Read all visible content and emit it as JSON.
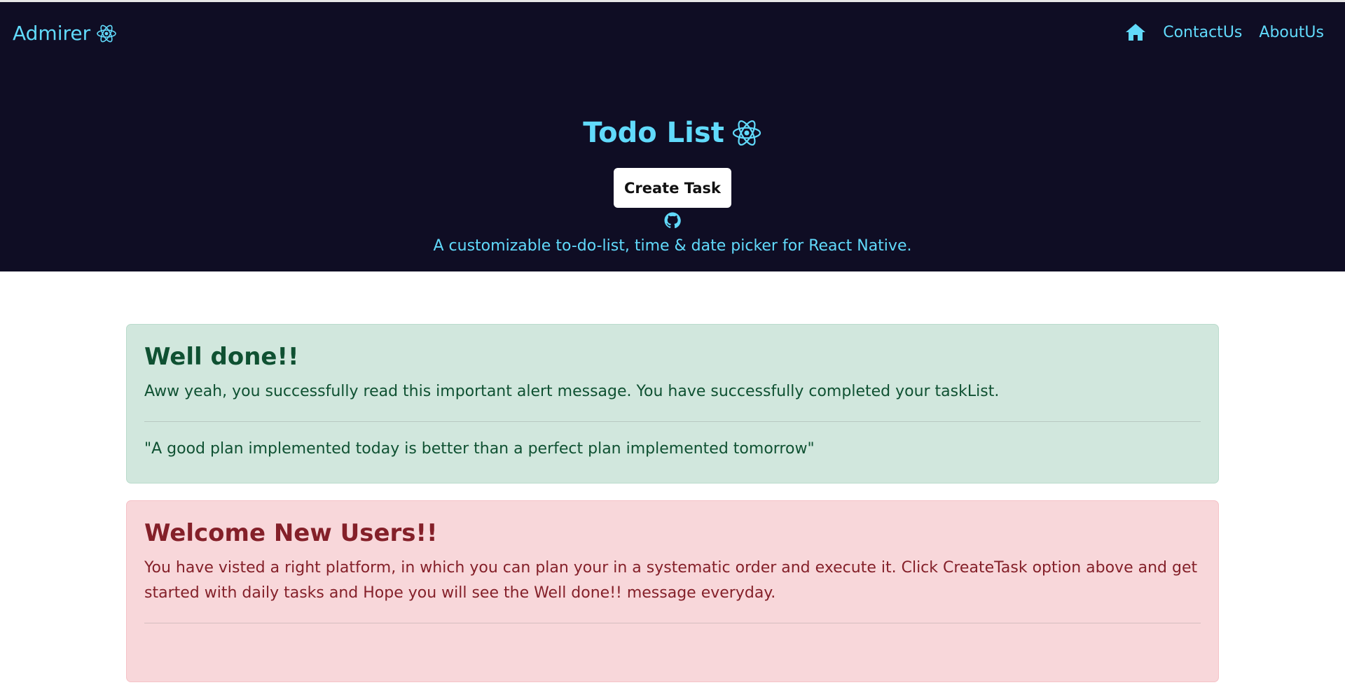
{
  "navbar": {
    "brand": "Admirer",
    "links": [
      {
        "label": "ContactUs"
      },
      {
        "label": "AboutUs"
      }
    ]
  },
  "hero": {
    "title": "Todo List",
    "create_button": "Create Task",
    "subtitle": "A customizable to-do-list, time & date picker for React Native."
  },
  "alerts": {
    "success": {
      "heading": "Well done!!",
      "text": "Aww yeah, you successfully read this important alert message. You have successfully completed your taskList.",
      "quote": "\"A good plan implemented today is better than a perfect plan implemented tomorrow\""
    },
    "danger": {
      "heading": "Welcome New Users!!",
      "text": "You have visted a right platform, in which you can plan your in a systematic order and execute it. Click CreateTask option above and get started with daily tasks and Hope you will see the Well done!! message everyday."
    }
  },
  "colors": {
    "hero_bg": "#0f0d24",
    "accent": "#61dafb",
    "success_bg": "#d1e7dd",
    "success_text": "#0f5132",
    "danger_bg": "#f8d7da",
    "danger_text": "#842029"
  },
  "icons": {
    "brand": "react-atom-icon",
    "home": "home-icon",
    "title": "react-atom-icon",
    "github": "github-icon"
  }
}
